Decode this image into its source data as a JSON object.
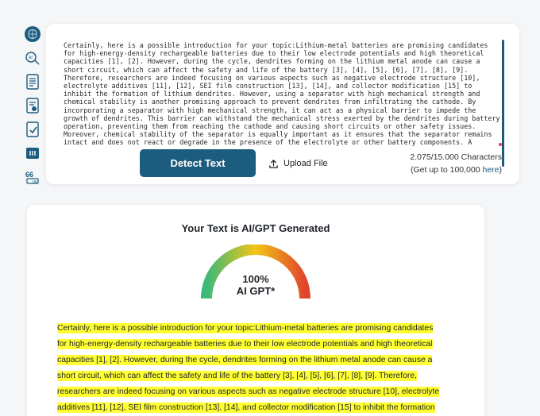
{
  "rail": {
    "icons": [
      "brain-logo-icon",
      "ai-chat-icon",
      "document-list-icon",
      "document-ai-icon",
      "document-check-icon",
      "compare-icon",
      "quote-icon"
    ]
  },
  "input": {
    "text": "Certainly, here is a possible introduction for your topic:Lithium-metal batteries are promising candidates for high-energy-density rechargeable batteries due to their low electrode potentials and high theoretical capacities [1], [2]. However, during the cycle, dendrites forming on the lithium metal anode can cause a short circuit, which can affect the safety and life of the battery [3], [4], [5], [6], [7], [8], [9]. Therefore, researchers are indeed focusing on various aspects such as negative electrode structure [10], electrolyte additives [11], [12], SEI film construction [13], [14], and collector modification [15] to inhibit the formation of lithium dendrites. However, using a separator with high mechanical strength and chemical stability is another promising approach to prevent dendrites from infiltrating the cathode. By incorporating a separator with high mechanical strength, it can act as a physical barrier to impede the growth of dendrites. This barrier can withstand the mechanical stress exerted by the dendrites during battery operation, preventing them from reaching the cathode and causing short circuits or other safety issues. Moreover, chemical stability of the separator is equally important as it ensures that the separator remains intact and does not react or degrade in the presence of the electrolyte or other battery components. A chemically stable separator helps to prevent the",
    "detect_label": "Detect Text",
    "upload_label": "Upload File",
    "char_count": "2.075/15.000 Characters",
    "upgrade_prefix": "(Get up to 100,000 ",
    "upgrade_link": "here",
    "upgrade_suffix": ")"
  },
  "result": {
    "title": "Your Text is AI/GPT Generated",
    "percent": "100%",
    "verdict": "AI GPT*",
    "ai_fraction": 1.0,
    "lines": [
      "Certainly, here is a possible introduction for your topic:Lithium-metal batteries are promising candidates",
      "for high-energy-density rechargeable batteries due to their low electrode potentials and high theoretical",
      "capacities [1], [2]. However, during the cycle, dendrites forming on the lithium metal anode can cause a",
      "short circuit, which can affect the safety and life of the battery [3], [4], [5], [6], [7], [8], [9]. Therefore,",
      "researchers are indeed focusing on various aspects such as negative electrode structure [10], electrolyte",
      "additives [11], [12], SEI film construction [13], [14], and collector modification [15] to inhibit the formation"
    ],
    "highlight_color": "#ffff33"
  },
  "colors": {
    "accent": "#1c5c7e",
    "gauge_start": "#3cb878",
    "gauge_mid": "#f2c516",
    "gauge_end": "#e0452b"
  }
}
